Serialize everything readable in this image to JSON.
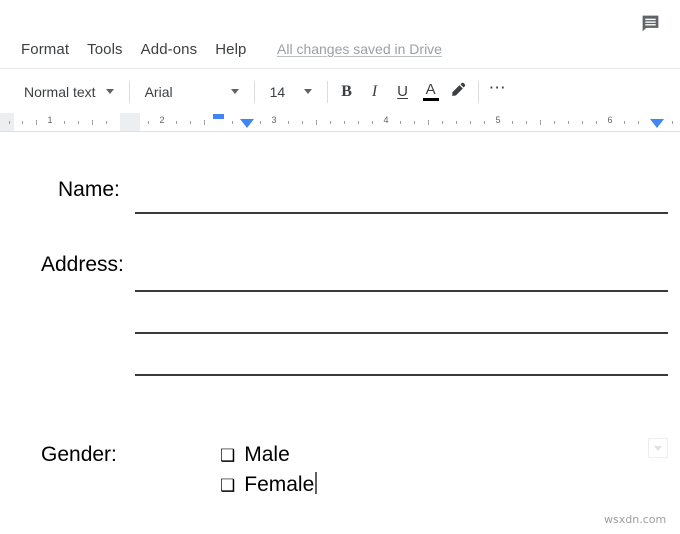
{
  "menubar": {
    "items": [
      {
        "label": "Format",
        "name": "menu-format"
      },
      {
        "label": "Tools",
        "name": "menu-tools"
      },
      {
        "label": "Add-ons",
        "name": "menu-addons"
      },
      {
        "label": "Help",
        "name": "menu-help"
      }
    ],
    "save_status": "All changes saved in Drive",
    "comment_icon": "comment-icon"
  },
  "toolbar": {
    "style_select": "Normal text",
    "font_select": "Arial",
    "font_size": "14",
    "bold_label": "B",
    "italic_label": "I",
    "underline_label": "U",
    "text_color_label": "A",
    "text_color_value": "#000000",
    "highlight_icon": "highlight-pen-icon",
    "more_label": "⋯"
  },
  "ruler": {
    "numbers": [
      "1",
      "2",
      "3",
      "4",
      "5",
      "6"
    ],
    "first_line_indent": "0.50",
    "left_indent": "0.75",
    "right_indent": "6.50"
  },
  "document": {
    "fields": [
      {
        "label": "Name:",
        "name": "field-name"
      },
      {
        "label": "Address:",
        "name": "field-address"
      },
      {
        "label": "Gender:",
        "name": "field-gender"
      }
    ],
    "gender_options": [
      {
        "checkbox": "❑",
        "label": "Male"
      },
      {
        "checkbox": "❑",
        "label": "Female"
      }
    ]
  },
  "outline_toggle": {
    "icon": "chevron-down-icon"
  },
  "watermark": {
    "text": "wsxdn.com"
  },
  "colors": {
    "accent_blue": "#4285f4",
    "text_primary": "#3c4043",
    "status_gray": "#9aa0a6"
  }
}
